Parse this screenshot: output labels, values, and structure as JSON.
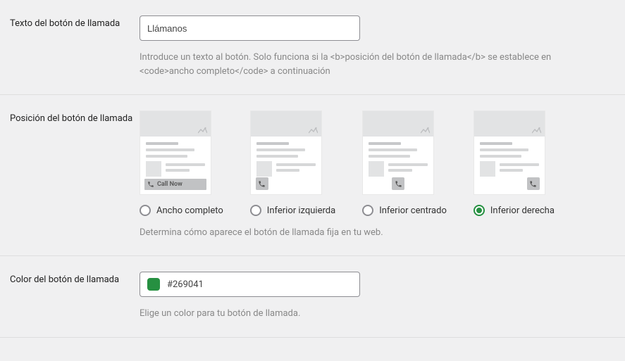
{
  "text_field": {
    "label": "Texto del botón de llamada",
    "value": "Llámanos",
    "help": "Introduce un texto al botón. Solo funciona si la <b>posición del botón de llamada</b> se establece en <code>ancho completo</code> a continuación"
  },
  "position_field": {
    "label": "Posición del botón de llamada",
    "help": "Determina cómo aparece el botón de llamada fija en tu web.",
    "call_now_text": "Call Now",
    "options": [
      {
        "label": "Ancho completo",
        "checked": false
      },
      {
        "label": "Inferior izquierda",
        "checked": false
      },
      {
        "label": "Inferior centrado",
        "checked": false
      },
      {
        "label": "Inferior derecha",
        "checked": true
      }
    ]
  },
  "color_field": {
    "label": "Color del botón de llamada",
    "value": "#269041",
    "help": "Elige un color para tu botón de llamada."
  }
}
